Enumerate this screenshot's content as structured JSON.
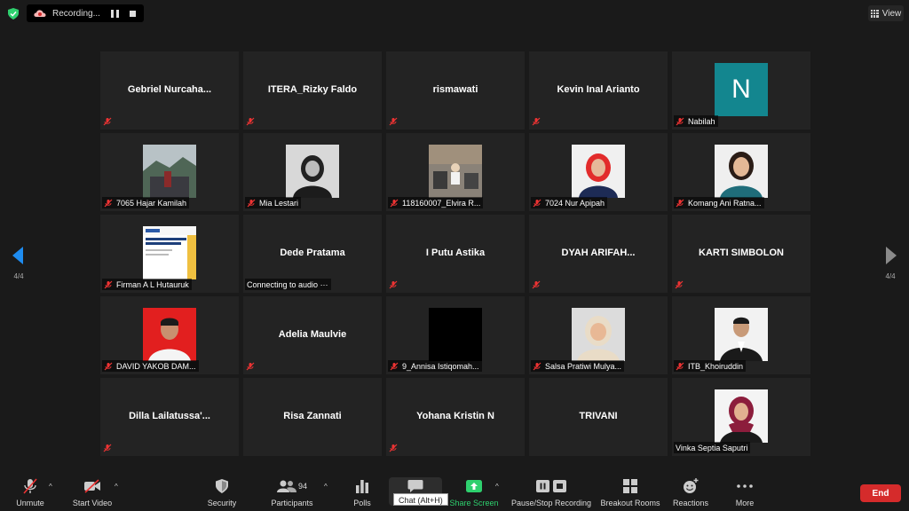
{
  "topbar": {
    "recording_label": "Recording...",
    "view_label": "View"
  },
  "tiles": [
    {
      "name": "Gebriel  Nurcaha...",
      "type": "name"
    },
    {
      "name": "ITERA_Rizky Faldo",
      "type": "name"
    },
    {
      "name": "rismawati",
      "type": "name"
    },
    {
      "name": "Kevin Inal Arianto",
      "type": "name"
    },
    {
      "name": "Nabilah",
      "type": "avatar",
      "initial": "N"
    },
    {
      "name": "7065 Hajar Kamilah",
      "type": "photo"
    },
    {
      "name": "Mia Lestari",
      "type": "photo"
    },
    {
      "name": "118160007_Elvira R...",
      "type": "photo"
    },
    {
      "name": "7024 Nur Apipah",
      "type": "photo"
    },
    {
      "name": "Komang Ani Ratna...",
      "type": "photo"
    },
    {
      "name": "Firman A L Hutauruk",
      "type": "photo"
    },
    {
      "name": "Dede Pratama",
      "type": "name",
      "status": "Connecting to audio"
    },
    {
      "name": "I Putu Astika",
      "type": "name"
    },
    {
      "name": "DYAH  ARIFAH...",
      "type": "name"
    },
    {
      "name": "KARTI SIMBOLON",
      "type": "name"
    },
    {
      "name": "DAVID YAKOB DAM...",
      "type": "photo"
    },
    {
      "name": "Adelia Maulvie",
      "type": "name"
    },
    {
      "name": "9_Annisa Istiqomah...",
      "type": "photo"
    },
    {
      "name": "Salsa Pratiwi Mulya...",
      "type": "photo"
    },
    {
      "name": "ITB_Khoiruddin",
      "type": "photo"
    },
    {
      "name": "Dilla  Lailatussa'...",
      "type": "name"
    },
    {
      "name": "Risa Zannati",
      "type": "name"
    },
    {
      "name": "Yohana Kristin N",
      "type": "name"
    },
    {
      "name": "TRIVANI",
      "type": "name"
    },
    {
      "name": "Vinka Septia Saputri",
      "type": "photo"
    }
  ],
  "pagination": {
    "left": "4/4",
    "right": "4/4"
  },
  "toolbar": {
    "unmute": "Unmute",
    "start_video": "Start Video",
    "security": "Security",
    "participants": "Participants",
    "participants_count": "94",
    "polls": "Polls",
    "chat_tooltip": "Chat (Alt+H)",
    "share_screen": "Share Screen",
    "recording": "Pause/Stop Recording",
    "breakout": "Breakout Rooms",
    "reactions": "Reactions",
    "more": "More",
    "end": "End"
  },
  "colors": {
    "share_green": "#2ed06e",
    "end_red": "#d52b2b",
    "avatar_teal": "#13868f"
  }
}
